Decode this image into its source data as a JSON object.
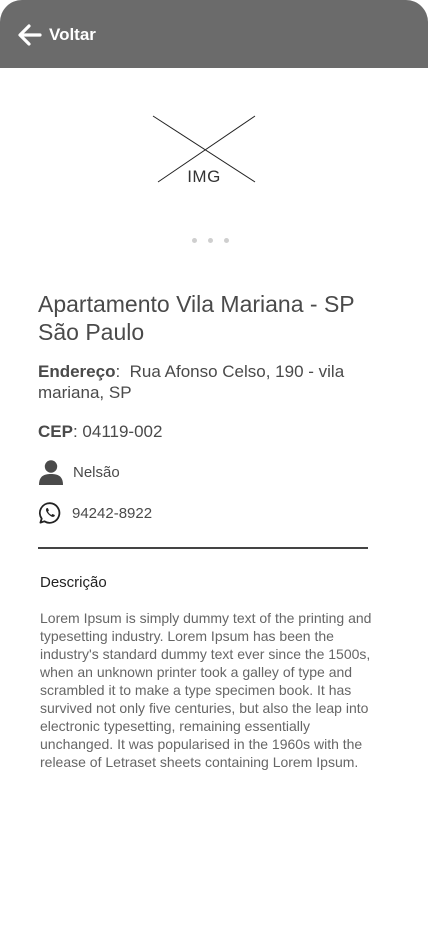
{
  "header": {
    "back_label": "Voltar",
    "background": "#6b6b6b"
  },
  "gallery": {
    "placeholder_label": "IMG",
    "dot_count": 3,
    "active_index": 0
  },
  "listing": {
    "title_line1": "Apartamento Vila Mariana - SP",
    "title_line2": "São Paulo",
    "address_label": "Endereço",
    "address_value": "Rua Afonso Celso, 190 - vila mariana, SP",
    "cep_label": "CEP",
    "cep_value": "04119-002",
    "owner_name": "Nelsão",
    "owner_icon": "user-icon",
    "phone": "94242-8922",
    "phone_icon": "whatsapp-icon"
  },
  "description": {
    "title": "Descrição",
    "text": "Lorem Ipsum is simply dummy text of the printing and typesetting industry. Lorem Ipsum has been the industry's standard dummy text ever since the 1500s, when an unknown printer took a galley of type and scrambled it to make a type specimen book. It has survived not only five centuries, but also the leap into electronic typesetting, remaining essentially unchanged. It was popularised in the 1960s with the release of Letraset sheets containing Lorem Ipsum."
  }
}
